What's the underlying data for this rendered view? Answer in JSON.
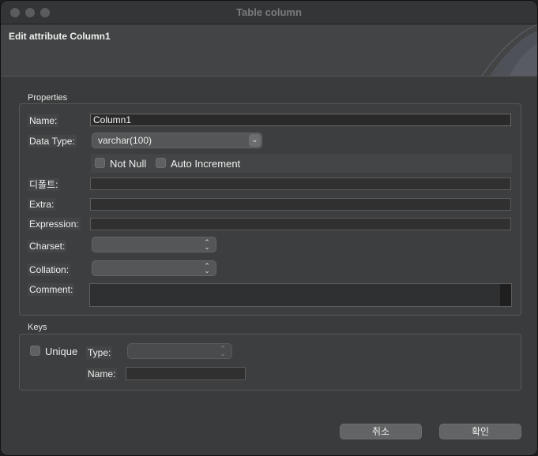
{
  "window": {
    "title": "Table column"
  },
  "header": {
    "title": "Edit attribute Column1"
  },
  "properties": {
    "section_label": "Properties",
    "name_label": "Name:",
    "name_value": "Column1",
    "datatype_label": "Data Type:",
    "datatype_value": "varchar(100)",
    "not_null_label": "Not Null",
    "not_null_checked": false,
    "auto_increment_label": "Auto Increment",
    "auto_increment_checked": false,
    "default_label": "디폴트:",
    "default_value": "",
    "extra_label": "Extra:",
    "extra_value": "",
    "expression_label": "Expression:",
    "expression_value": "",
    "charset_label": "Charset:",
    "charset_value": "",
    "collation_label": "Collation:",
    "collation_value": "",
    "comment_label": "Comment:",
    "comment_value": ""
  },
  "keys": {
    "section_label": "Keys",
    "unique_label": "Unique",
    "unique_checked": false,
    "type_label": "Type:",
    "type_value": "",
    "name_label": "Name:",
    "name_value": ""
  },
  "buttons": {
    "cancel": "취소",
    "ok": "확인"
  },
  "colors": {
    "window_bg": "#3a3b3c",
    "header_bg": "#434445",
    "field_bg": "#303031",
    "button_bg": "#636465"
  },
  "icons": {
    "select_arrow": "chevron-down-icon",
    "popup_arrows": "updown-chevron-icon"
  }
}
